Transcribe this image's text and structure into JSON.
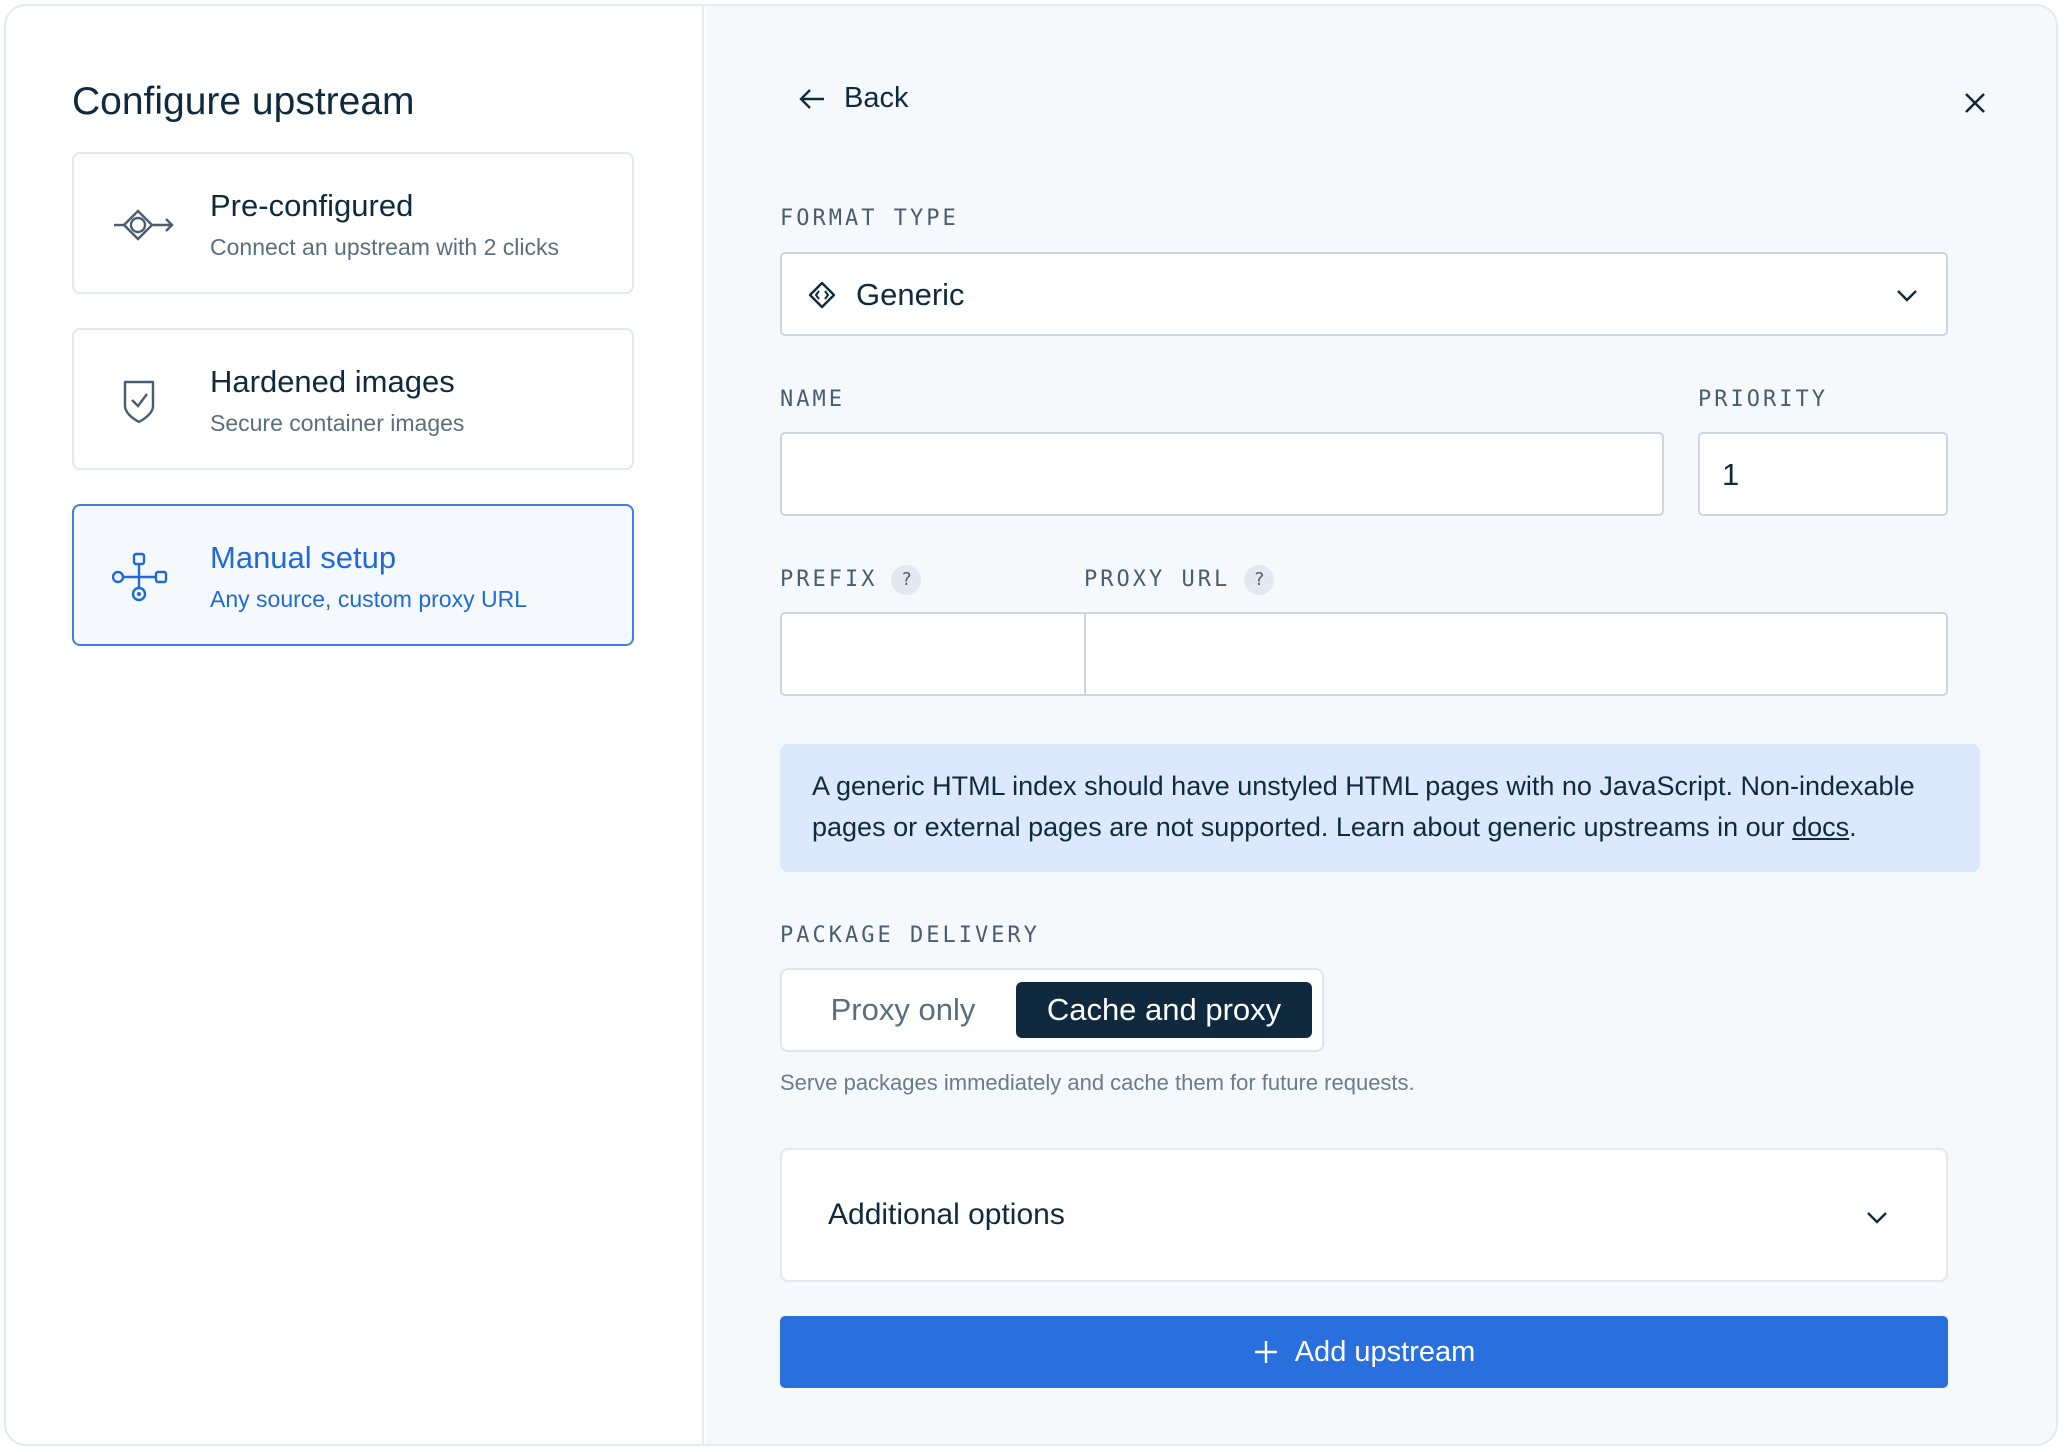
{
  "left": {
    "title": "Configure upstream",
    "options": [
      {
        "title": "Pre-configured",
        "subtitle": "Connect an upstream with 2 clicks",
        "icon": "connect-icon",
        "selected": false
      },
      {
        "title": "Hardened images",
        "subtitle": "Secure container images",
        "icon": "shield-check-icon",
        "selected": false
      },
      {
        "title": "Manual setup",
        "subtitle": "Any source, custom proxy URL",
        "icon": "network-icon",
        "selected": true
      }
    ]
  },
  "header": {
    "back_label": "Back"
  },
  "form": {
    "format_type_label": "FORMAT TYPE",
    "format_type_value": "Generic",
    "name_label": "NAME",
    "name_value": "",
    "priority_label": "PRIORITY",
    "priority_value": "1",
    "prefix_label": "PREFIX",
    "prefix_value": "",
    "proxy_url_label": "PROXY URL",
    "proxy_url_value": "",
    "help_glyph": "?"
  },
  "info": {
    "text": "A generic HTML index should have unstyled HTML pages with no JavaScript. Non-indexable pages or external pages are not supported. Learn about generic upstreams in our ",
    "link": "docs",
    "end": "."
  },
  "delivery": {
    "label": "PACKAGE DELIVERY",
    "options": [
      "Proxy only",
      "Cache and proxy"
    ],
    "selected": "Cache and proxy",
    "hint": "Serve packages immediately and cache them for future requests."
  },
  "additional": {
    "label": "Additional options"
  },
  "submit": {
    "label": "Add upstream"
  },
  "colors": {
    "accent": "#2a6fde",
    "selected_border": "#3f7fe0",
    "info_bg": "#dce8fb",
    "dark": "#0f2a3f"
  }
}
